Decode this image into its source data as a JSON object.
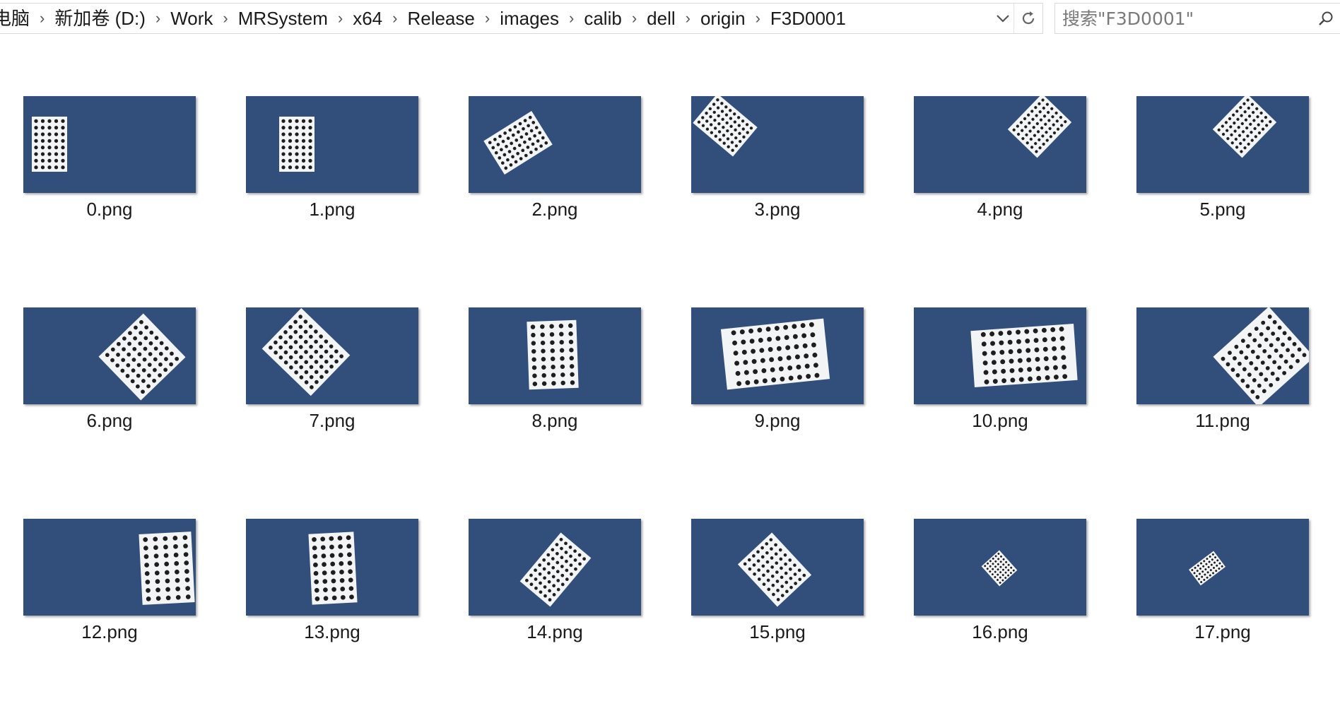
{
  "breadcrumb": {
    "items": [
      "电脑",
      "新加卷 (D:)",
      "Work",
      "MRSystem",
      "x64",
      "Release",
      "images",
      "calib",
      "dell",
      "origin",
      "F3D0001"
    ]
  },
  "search": {
    "placeholder": "搜索\"F3D0001\""
  },
  "icons": {
    "separator": "chevron-right-icon",
    "dropdown": "chevron-down-icon",
    "refresh": "refresh-icon",
    "search": "search-icon"
  },
  "colors": {
    "thumbnail_background": "#324e7b",
    "calibration_board": "#f2f4f6",
    "calibration_dot": "#1e1e1e"
  },
  "files": [
    {
      "name": "0.png"
    },
    {
      "name": "1.png"
    },
    {
      "name": "2.png"
    },
    {
      "name": "3.png"
    },
    {
      "name": "4.png"
    },
    {
      "name": "5.png"
    },
    {
      "name": "6.png"
    },
    {
      "name": "7.png"
    },
    {
      "name": "8.png"
    },
    {
      "name": "9.png"
    },
    {
      "name": "10.png"
    },
    {
      "name": "11.png"
    },
    {
      "name": "12.png"
    },
    {
      "name": "13.png"
    },
    {
      "name": "14.png"
    },
    {
      "name": "15.png"
    },
    {
      "name": "16.png"
    },
    {
      "name": "17.png"
    }
  ]
}
